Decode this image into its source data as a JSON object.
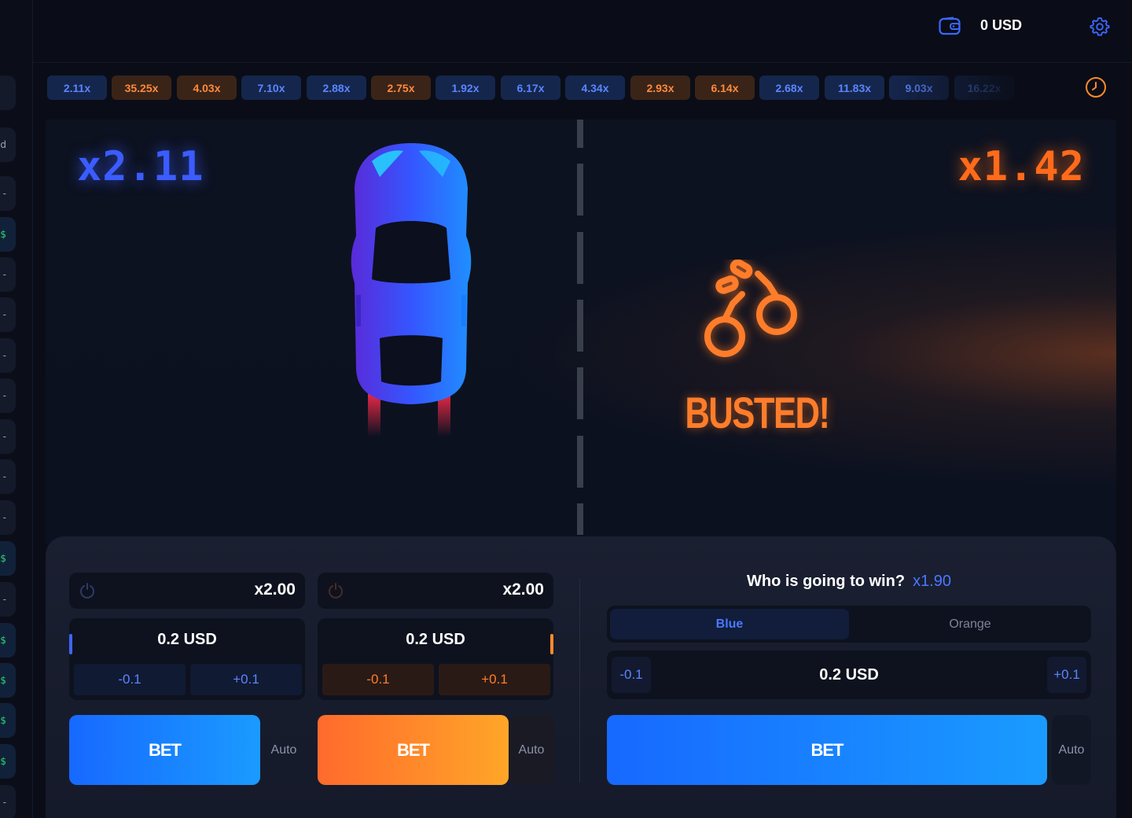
{
  "header": {
    "balance": "0 USD",
    "icons": [
      "wallet-icon",
      "gear-icon"
    ]
  },
  "history": {
    "chips": [
      {
        "label": "2.11x",
        "color": "blue"
      },
      {
        "label": "35.25x",
        "color": "orange"
      },
      {
        "label": "4.03x",
        "color": "orange"
      },
      {
        "label": "7.10x",
        "color": "blue"
      },
      {
        "label": "2.88x",
        "color": "blue"
      },
      {
        "label": "2.75x",
        "color": "orange"
      },
      {
        "label": "1.92x",
        "color": "blue"
      },
      {
        "label": "6.17x",
        "color": "blue"
      },
      {
        "label": "4.34x",
        "color": "blue"
      },
      {
        "label": "2.93x",
        "color": "orange"
      },
      {
        "label": "6.14x",
        "color": "orange"
      },
      {
        "label": "2.68x",
        "color": "blue"
      },
      {
        "label": "11.83x",
        "color": "blue"
      },
      {
        "label": "9.03x",
        "color": "blue"
      },
      {
        "label": "16.22x",
        "color": "blue"
      }
    ],
    "history_icon": "clock-icon"
  },
  "arena": {
    "blue_multiplier": "x2.11",
    "orange_multiplier": "x1.42",
    "result_text": "BUSTED!",
    "colors": {
      "blue": "#3b5cff",
      "orange": "#ff6b1a"
    }
  },
  "bets": {
    "blue": {
      "auto_cashout": "x2.00",
      "amount": "0.2 USD",
      "minus": "-0.1",
      "plus": "+0.1",
      "bet_label": "BET",
      "auto_label": "Auto"
    },
    "orange": {
      "auto_cashout": "x2.00",
      "amount": "0.2 USD",
      "minus": "-0.1",
      "plus": "+0.1",
      "bet_label": "BET",
      "auto_label": "Auto"
    },
    "duel": {
      "question": "Who is going to win?",
      "multiplier": "x1.90",
      "options": [
        "Blue",
        "Orange"
      ],
      "selected": "Blue",
      "amount": "0.2 USD",
      "minus": "-0.1",
      "plus": "+0.1",
      "bet_label": "BET",
      "auto_label": "Auto"
    }
  }
}
